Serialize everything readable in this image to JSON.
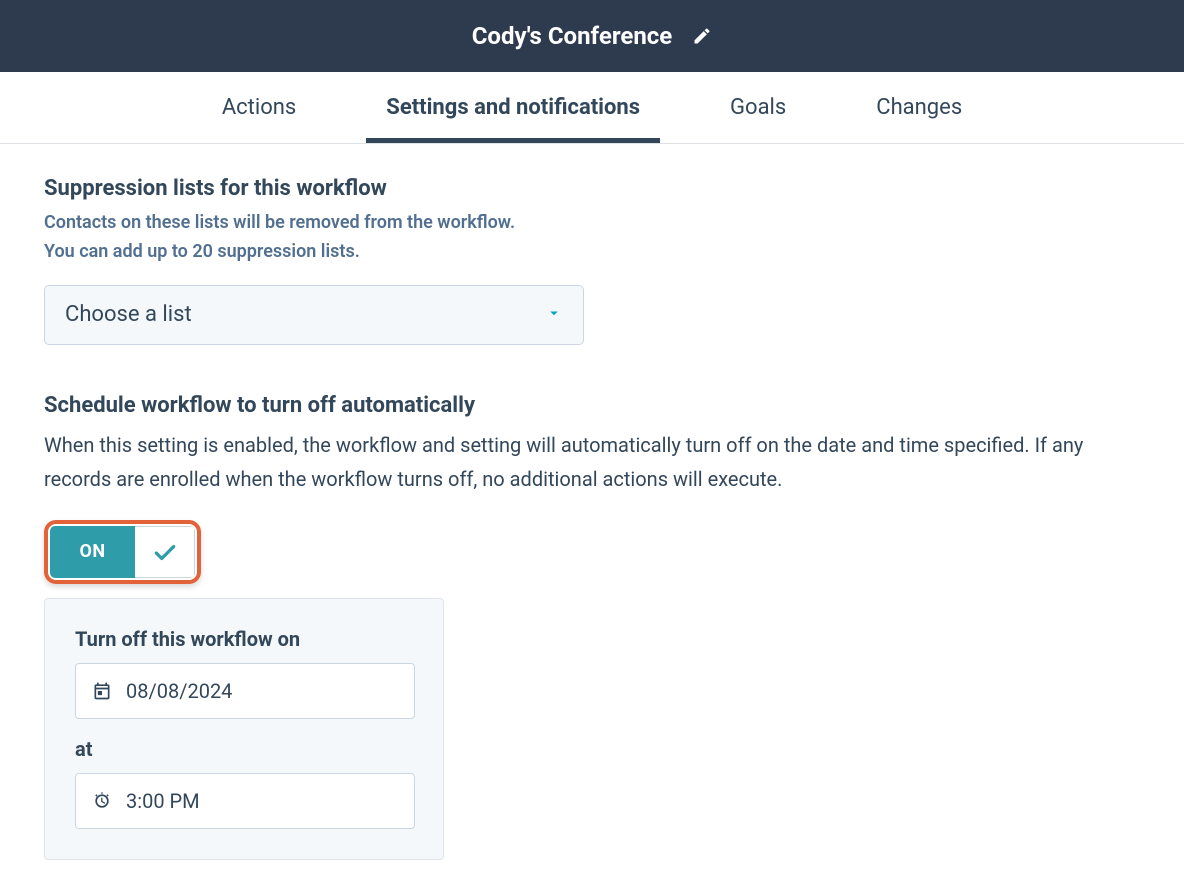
{
  "header": {
    "title": "Cody's Conference"
  },
  "tabs": {
    "items": [
      {
        "label": "Actions",
        "active": false
      },
      {
        "label": "Settings and notifications",
        "active": true
      },
      {
        "label": "Goals",
        "active": false
      },
      {
        "label": "Changes",
        "active": false
      }
    ]
  },
  "suppression": {
    "title": "Suppression lists for this workflow",
    "desc_line1": "Contacts on these lists will be removed from the workflow.",
    "desc_line2": "You can add up to 20 suppression lists.",
    "dropdown_label": "Choose a list"
  },
  "schedule": {
    "title": "Schedule workflow to turn off automatically",
    "desc": "When this setting is enabled, the workflow and setting will automatically turn off on the date and time specified. If any records are enrolled when the workflow turns off, no additional actions will execute.",
    "toggle_state": "ON",
    "panel": {
      "date_label": "Turn off this workflow on",
      "date_value": "08/08/2024",
      "time_label": "at",
      "time_value": "3:00 PM"
    }
  }
}
